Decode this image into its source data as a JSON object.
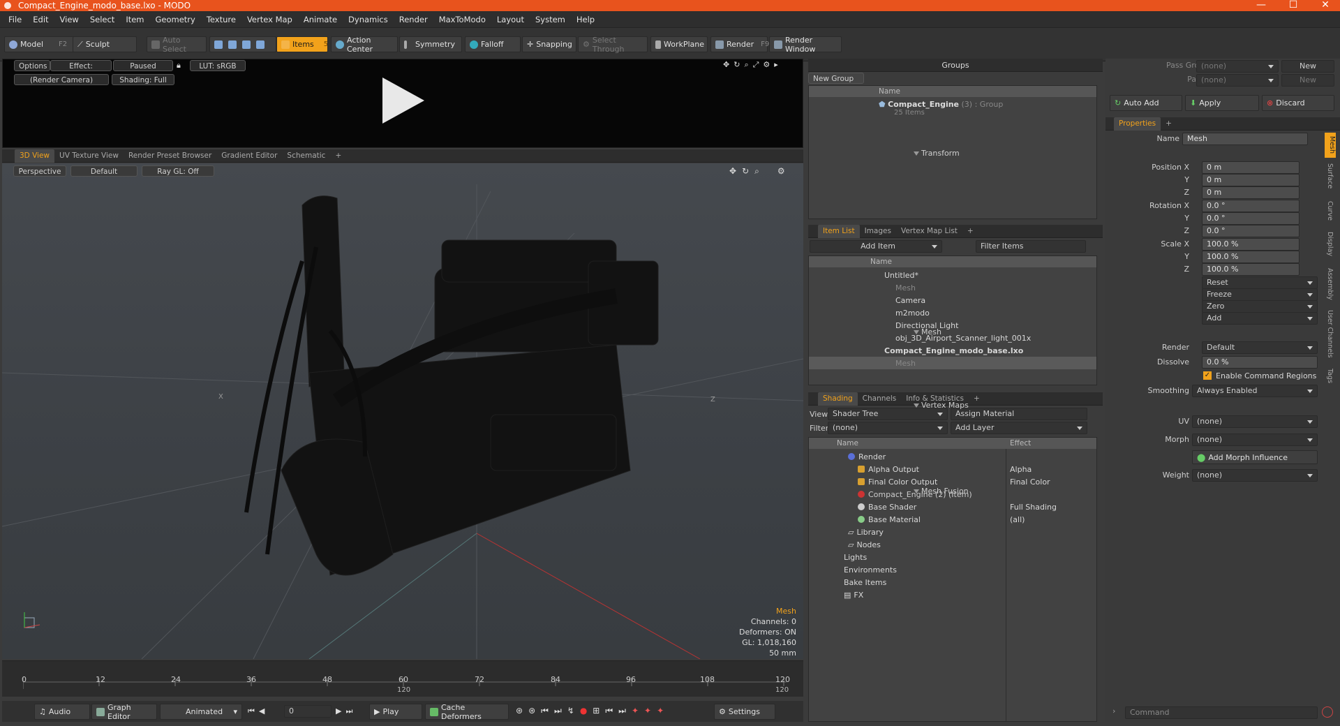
{
  "window": {
    "title": "Compact_Engine_modo_base.lxo - MODO",
    "min": "—",
    "max": "☐",
    "close": "✕"
  },
  "menu": [
    "File",
    "Edit",
    "View",
    "Select",
    "Item",
    "Geometry",
    "Texture",
    "Vertex Map",
    "Animate",
    "Dynamics",
    "Render",
    "MaxToModo",
    "Layout",
    "System",
    "Help"
  ],
  "toolbar": {
    "model": "Model",
    "model_key": "F2",
    "sculpt": "Sculpt",
    "auto_select": "Auto Select",
    "items": "Items",
    "items_key": "5",
    "action_center": "Action Center",
    "symmetry": "Symmetry",
    "falloff": "Falloff",
    "snapping": "Snapping",
    "select_through": "Select Through",
    "workplane": "WorkPlane",
    "render": "Render",
    "render_key": "F9",
    "render_window": "Render Window"
  },
  "preview": {
    "options": "Options",
    "effect": "Effect: (Shadi...",
    "paused": "Paused",
    "lut": "LUT: sRGB",
    "camera": "(Render Camera)",
    "shading": "Shading: Full"
  },
  "viewport_tabs": [
    "3D View",
    "UV Texture View",
    "Render Preset Browser",
    "Gradient Editor",
    "Schematic",
    "+"
  ],
  "viewport": {
    "perspective": "Perspective",
    "style": "Default",
    "raygl": "Ray GL: Off",
    "info_title": "Mesh",
    "info": [
      "Channels: 0",
      "Deformers: ON",
      "GL: 1,018,160",
      "50 mm"
    ]
  },
  "timeline": {
    "ticks": [
      "0",
      "12",
      "24",
      "36",
      "48",
      "60",
      "72",
      "84",
      "96",
      "108",
      "120"
    ],
    "end": "120",
    "end2": "120"
  },
  "bottom": {
    "audio": "Audio",
    "graph_editor": "Graph Editor",
    "animated": "Animated",
    "frame": "0",
    "play": "Play",
    "cache": "Cache Deformers",
    "settings": "Settings"
  },
  "groups": {
    "title": "Groups",
    "new_group": "New Group",
    "col_name": "Name",
    "item": "Compact_Engine",
    "item_count": "(3)",
    "item_type": ": Group",
    "item_sub": "25 Items"
  },
  "itemlist": {
    "tabs": [
      "Item List",
      "Images",
      "Vertex Map List",
      "+"
    ],
    "add_item": "Add Item",
    "filter": "Filter Items",
    "col_name": "Name",
    "rows": [
      {
        "label": "Untitled*",
        "indent": 0,
        "style": "normal"
      },
      {
        "label": "Mesh",
        "indent": 2,
        "style": "dim"
      },
      {
        "label": "Camera",
        "indent": 2,
        "style": "normal"
      },
      {
        "label": "m2modo",
        "indent": 1,
        "style": "normal"
      },
      {
        "label": "Directional Light",
        "indent": 2,
        "style": "normal"
      },
      {
        "label": "obj_3D_Airport_Scanner_light_001x",
        "indent": 2,
        "style": "normal"
      },
      {
        "label": "Compact_Engine_modo_base.lxo",
        "indent": 0,
        "style": "bold"
      },
      {
        "label": "Mesh",
        "indent": 2,
        "style": "sel"
      }
    ]
  },
  "shading": {
    "tabs": [
      "Shading",
      "Channels",
      "Info & Statistics",
      "+"
    ],
    "view_label": "View",
    "view": "Shader Tree",
    "assign": "Assign Material",
    "filter_label": "Filter",
    "filter": "(none)",
    "add_layer": "Add Layer",
    "col_name": "Name",
    "col_effect": "Effect",
    "rows": [
      {
        "label": "Render",
        "effect": "",
        "indent": 0,
        "color": "#5a6fd8"
      },
      {
        "label": "Alpha Output",
        "effect": "Alpha",
        "indent": 1,
        "color": "#d8a030"
      },
      {
        "label": "Final Color Output",
        "effect": "Final Color",
        "indent": 1,
        "color": "#d8a030"
      },
      {
        "label": "Compact_Engine (2) (Item)",
        "effect": "",
        "indent": 1,
        "color": "#c33"
      },
      {
        "label": "Base Shader",
        "effect": "Full Shading",
        "indent": 1,
        "color": "#ccc"
      },
      {
        "label": "Base Material",
        "effect": "(all)",
        "indent": 1,
        "color": "#8c8"
      },
      {
        "label": "Library",
        "effect": "",
        "indent": 0,
        "color": ""
      },
      {
        "label": "Nodes",
        "effect": "",
        "indent": 0,
        "color": ""
      },
      {
        "label": "Lights",
        "effect": "",
        "indent": 0,
        "color": ""
      },
      {
        "label": "Environments",
        "effect": "",
        "indent": 0,
        "color": ""
      },
      {
        "label": "Bake Items",
        "effect": "",
        "indent": 0,
        "color": ""
      },
      {
        "label": "FX",
        "effect": "",
        "indent": 0,
        "color": ""
      }
    ]
  },
  "props": {
    "pass_groups": "Pass Groups",
    "pass_groups_val": "(none)",
    "new": "New",
    "passes": "Passes",
    "passes_val": "(none)",
    "new2": "New",
    "auto_add": "Auto Add",
    "apply": "Apply",
    "discard": "Discard",
    "tab": "Properties",
    "name_label": "Name",
    "name": "Mesh",
    "transform": "Transform",
    "position_label": "Position X",
    "rotation_label": "Rotation X",
    "scale_label": "Scale X",
    "y": "Y",
    "z": "Z",
    "px": "0 m",
    "py": "0 m",
    "pz": "0 m",
    "rx": "0.0 °",
    "ry": "0.0 °",
    "rz": "0.0 °",
    "sx": "100.0 %",
    "sy": "100.0 %",
    "sz": "100.0 %",
    "reset": "Reset",
    "freeze": "Freeze",
    "zero": "Zero",
    "add": "Add",
    "mesh": "Mesh",
    "render_label": "Render",
    "render": "Default",
    "dissolve_label": "Dissolve",
    "dissolve": "0.0 %",
    "cmd_regions": "Enable Command Regions",
    "smoothing_label": "Smoothing",
    "smoothing": "Always Enabled",
    "vertex_maps": "Vertex Maps",
    "uv_label": "UV",
    "uv": "(none)",
    "morph_label": "Morph",
    "morph": "(none)",
    "add_morph": "Add Morph Influence",
    "weight_label": "Weight",
    "weight": "(none)",
    "mesh_fusion": "Mesh Fusion",
    "side_tabs": [
      "Mesh",
      "Surface",
      "Curve",
      "Display",
      "Assembly",
      "User Channels",
      "Tags"
    ],
    "command": "Command"
  }
}
